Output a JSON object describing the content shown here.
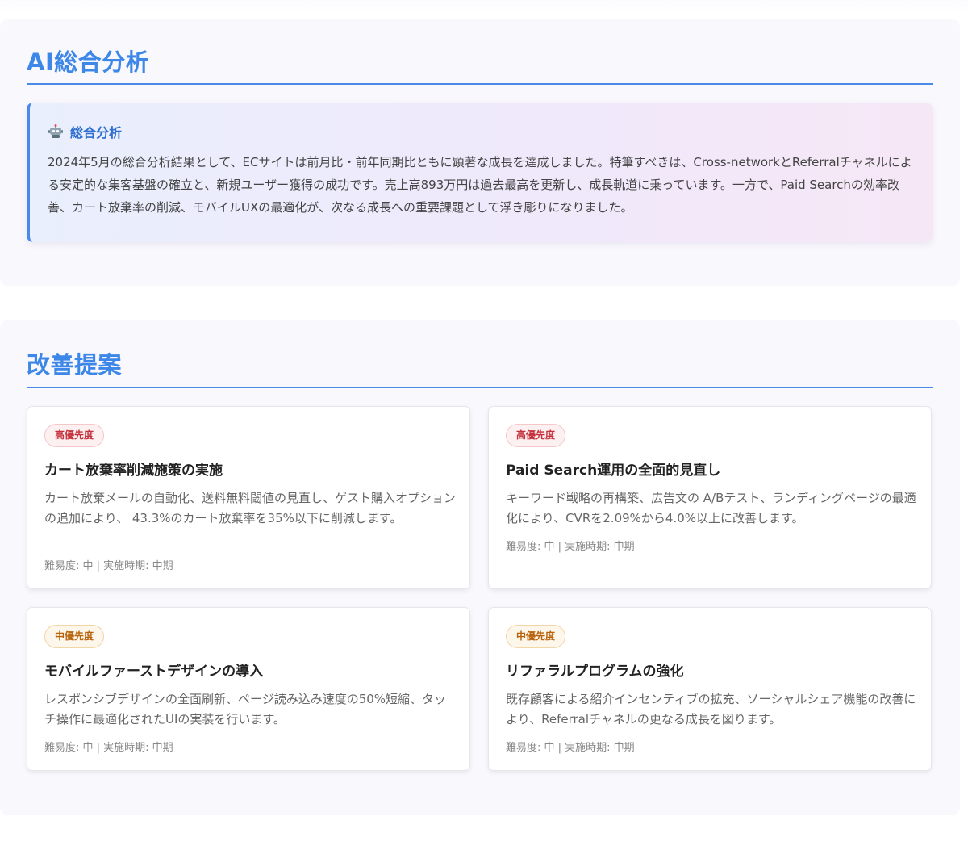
{
  "analysis": {
    "title": "AI総合分析",
    "summary_label": "総合分析",
    "summary_icon": "robot-icon",
    "summary_text": "2024年5月の総合分析結果として、ECサイトは前月比・前年同期比ともに顕著な成長を達成しました。特筆すべきは、Cross-networkとReferralチャネルによる安定的な集客基盤の確立と、新規ユーザー獲得の成功です。売上高893万円は過去最高を更新し、成長軌道に乗っています。一方で、Paid Searchの効率改善、カート放棄率の削減、モバイルUXの最適化が、次なる成長への重要課題として浮き彫りになりました。"
  },
  "suggestions": {
    "title": "改善提案",
    "cards": [
      {
        "priority": "高優先度",
        "title": "カート放棄率削減施策の実施",
        "desc": "カート放棄メールの自動化、送料無料閾値の見直し、ゲスト購入オプションの追加により、 43.3%のカート放棄率を35%以下に削減します。",
        "meta": "難易度: 中 | 実施時期: 中期"
      },
      {
        "priority": "高優先度",
        "title": "Paid Search運用の全面的見直し",
        "desc": "キーワード戦略の再構築、広告文の A/Bテスト、ランディングページの最適化により、CVRを2.09%から4.0%以上に改善します。",
        "meta": "難易度: 中 | 実施時期: 中期"
      },
      {
        "priority": "中優先度",
        "title": "モバイルファーストデザインの導入",
        "desc": "レスポンシブデザインの全面刷新、ページ読み込み速度の50%短縮、タッチ操作に最適化されたUIの実装を行います。",
        "meta": "難易度: 中 | 実施時期: 中期"
      },
      {
        "priority": "中優先度",
        "title": "リファラルプログラムの強化",
        "desc": "既存顧客による紹介インセンティブの拡充、ソーシャルシェア機能の改善により、Referralチャネルの更なる成長を図ります。",
        "meta": "難易度: 中 | 実施時期: 中期"
      }
    ]
  },
  "colors": {
    "accent": "#3d87e8",
    "high_priority": "#c4303c",
    "mid_priority": "#b8620c"
  }
}
